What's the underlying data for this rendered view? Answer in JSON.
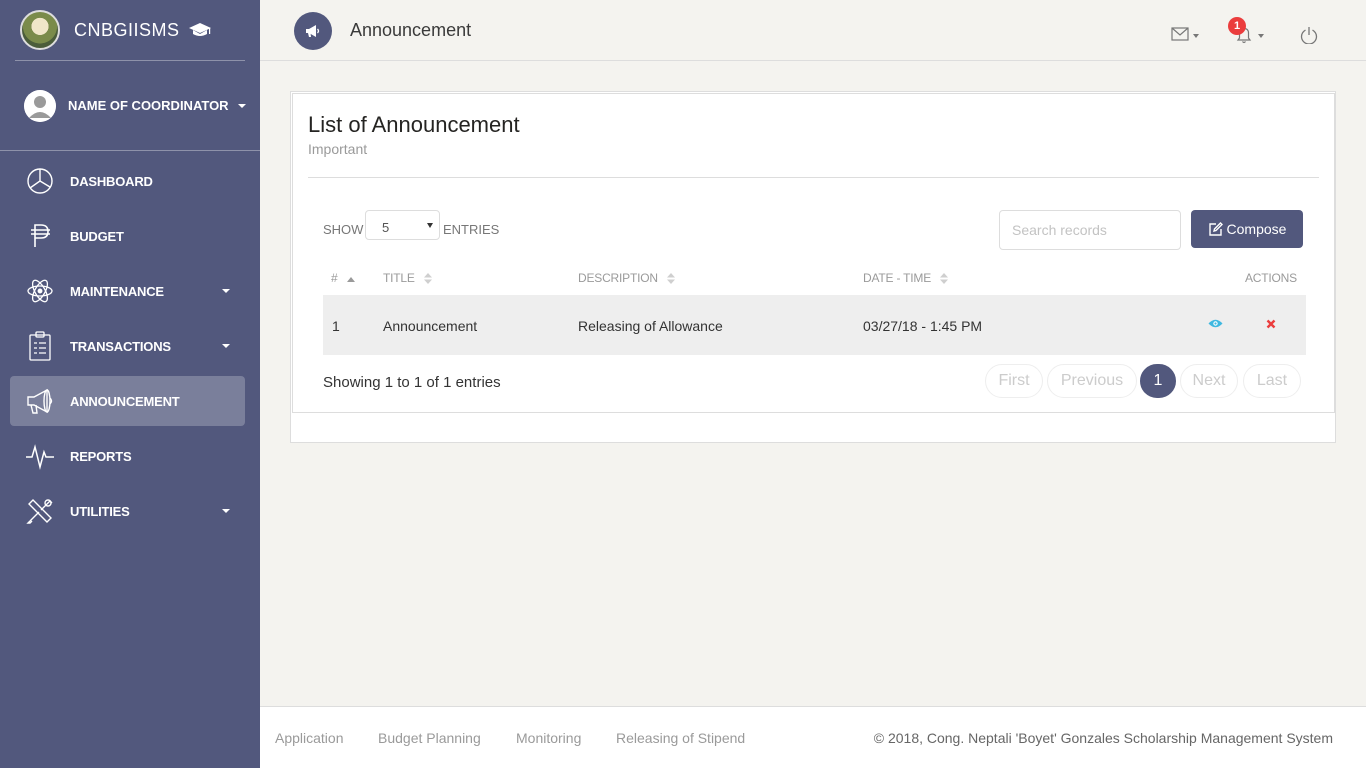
{
  "sidebar": {
    "brand": "CNBGIISMS",
    "user_name": "NAME OF COORDINATOR",
    "items": [
      {
        "label": "DASHBOARD"
      },
      {
        "label": "BUDGET"
      },
      {
        "label": "MAINTENANCE"
      },
      {
        "label": "TRANSACTIONS"
      },
      {
        "label": "ANNOUNCEMENT"
      },
      {
        "label": "REPORTS"
      },
      {
        "label": "UTILITIES"
      }
    ]
  },
  "topbar": {
    "title": "Announcement",
    "notification_count": "1"
  },
  "card": {
    "title": "List of Announcement",
    "subtitle": "Important",
    "show_label": "SHOW",
    "entries_value": "5",
    "entries_label": "ENTRIES",
    "search_placeholder": "Search records",
    "compose_label": "Compose",
    "columns": [
      "#",
      "TITLE",
      "DESCRIPTION",
      "DATE - TIME",
      "ACTIONS"
    ],
    "rows": [
      {
        "num": "1",
        "title": "Announcement",
        "description": "Releasing of Allowance",
        "datetime": "03/27/18 - 1:45 PM"
      }
    ],
    "showing": "Showing 1 to 1 of 1 entries",
    "pagination": [
      "First",
      "Previous",
      "1",
      "Next",
      "Last"
    ]
  },
  "footer": {
    "links": [
      "Application",
      "Budget Planning",
      "Monitoring",
      "Releasing of Stipend"
    ],
    "copyright": "© 2018, Cong. Neptali 'Boyet' Gonzales Scholarship Management System"
  },
  "colors": {
    "sidebar": "#52587d",
    "active_item": "#7a7f9b",
    "accent": "#52587d",
    "badge": "#eb3d3d",
    "view_icon": "#3fb8e0",
    "delete_icon": "#eb3d3d"
  }
}
